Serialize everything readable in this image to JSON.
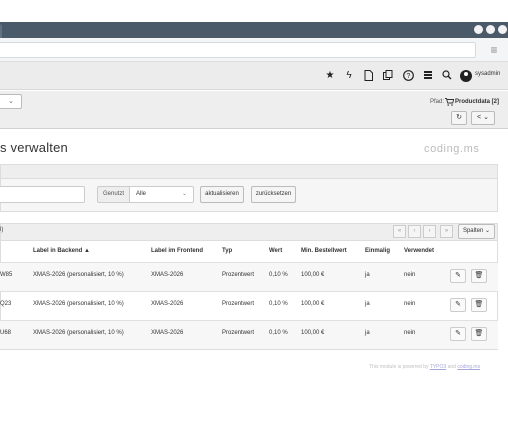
{
  "toolbar": {
    "username": "sysadmin",
    "icons": [
      "star-icon",
      "bolt-icon",
      "document-icon",
      "copy-icon",
      "help-icon",
      "system-info-icon",
      "search-icon",
      "avatar"
    ]
  },
  "docheader": {
    "module_select_chevron": "⌄",
    "path_label": "Pfad:",
    "path_value": "Productdata [2]",
    "reload_glyph": "↻",
    "share_glyph": "< ⌄"
  },
  "page": {
    "title": "s verwalten",
    "logo": "coding.ms"
  },
  "filter": {
    "used_label": "Genutzt",
    "used_value": "Alle",
    "refresh_label": "aktualisieren",
    "reset_label": "zurücksetzen"
  },
  "list": {
    "count": "3)",
    "pager": [
      "«",
      "‹",
      "›",
      "»"
    ],
    "columns_button": "Spalten ⌄",
    "headers": {
      "code": "",
      "label_backend": "Label in Backend ▲",
      "label_frontend": "Label im Frontend",
      "type": "Typ",
      "value": "Wert",
      "min_order": "Min. Bestellwert",
      "once": "Einmalig",
      "used": "Verwendet"
    },
    "rows": [
      {
        "code": "W85",
        "label_backend": "XMAS-2026 (personalisiert, 10 %)",
        "label_frontend": "XMAS-2026",
        "type": "Prozentwert",
        "value": "0,10 %",
        "min_order": "100,00 €",
        "once": "ja",
        "used": "nein"
      },
      {
        "code": "Q23",
        "label_backend": "XMAS-2026 (personalisiert, 10 %)",
        "label_frontend": "XMAS-2026",
        "type": "Prozentwert",
        "value": "0,10 %",
        "min_order": "100,00 €",
        "once": "ja",
        "used": "nein"
      },
      {
        "code": "U68",
        "label_backend": "XMAS-2026 (personalisiert, 10 %)",
        "label_frontend": "XMAS-2026",
        "type": "Prozentwert",
        "value": "0,10 %",
        "min_order": "100,00 €",
        "once": "ja",
        "used": "nein"
      }
    ]
  },
  "footer": {
    "text": "This module is powered by ",
    "link1": "TYPO3",
    "and": " and ",
    "link2": "coding.ms"
  }
}
